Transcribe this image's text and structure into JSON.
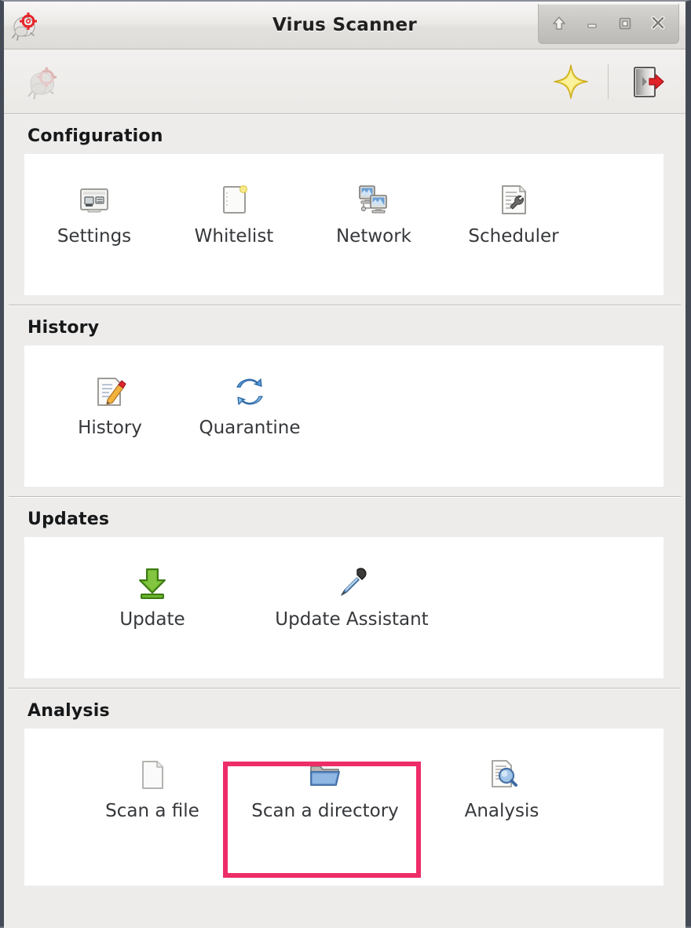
{
  "window": {
    "title": "Virus Scanner",
    "app_icon": "virus-target-icon",
    "controls": [
      {
        "name": "shade-button",
        "icon": "arrow-up-icon"
      },
      {
        "name": "minimize-button",
        "icon": "minimize-icon"
      },
      {
        "name": "maximize-button",
        "icon": "maximize-icon"
      },
      {
        "name": "close-button",
        "icon": "close-icon"
      }
    ]
  },
  "toolbar": {
    "left_items": [
      {
        "name": "scan-toolbar-button",
        "icon": "virus-target-disabled-icon",
        "enabled": false
      }
    ],
    "right_items": [
      {
        "name": "wizard-toolbar-button",
        "icon": "yellow-star-icon"
      },
      {
        "name": "quit-toolbar-button",
        "icon": "exit-door-icon"
      }
    ]
  },
  "sections": [
    {
      "title": "Configuration",
      "items": [
        {
          "label": "Settings",
          "icon": "settings-monitors-icon"
        },
        {
          "label": "Whitelist",
          "icon": "whitelist-page-icon"
        },
        {
          "label": "Network",
          "icon": "network-computers-icon"
        },
        {
          "label": "Scheduler",
          "icon": "scheduler-document-wrench-icon"
        }
      ]
    },
    {
      "title": "History",
      "items": [
        {
          "label": "History",
          "icon": "history-document-pencil-icon"
        },
        {
          "label": "Quarantine",
          "icon": "quarantine-refresh-icon"
        }
      ]
    },
    {
      "title": "Updates",
      "items": [
        {
          "label": "Update",
          "icon": "update-download-arrow-icon"
        },
        {
          "label": "Update Assistant",
          "icon": "update-assistant-pipette-icon"
        }
      ]
    },
    {
      "title": "Analysis",
      "items": [
        {
          "label": "Scan a file",
          "icon": "file-page-icon"
        },
        {
          "label": "Scan a directory",
          "icon": "folder-open-icon"
        },
        {
          "label": "Analysis",
          "icon": "analysis-magnifier-icon"
        }
      ]
    }
  ],
  "annotation": {
    "target": "Scan a directory",
    "color": "#ed2d68"
  }
}
